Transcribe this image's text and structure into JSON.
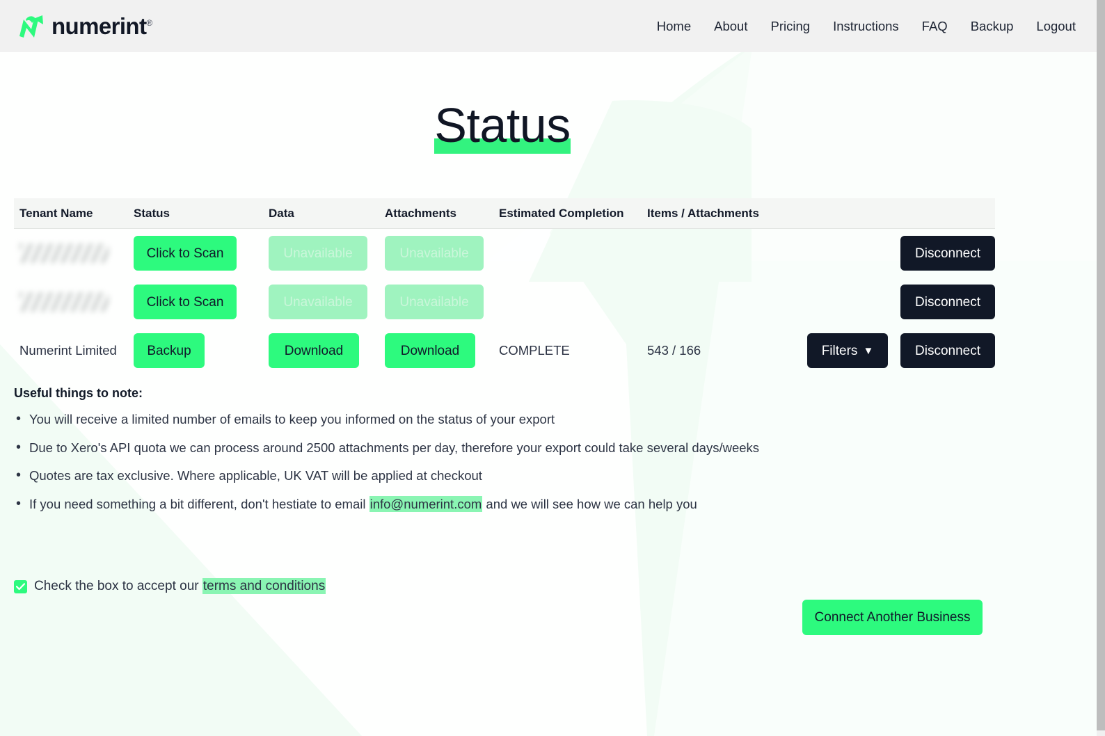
{
  "brand": {
    "name": "numerint",
    "registered_mark": "®",
    "logo_icon": "numerint-n-arrow-logo",
    "accent_green": "#2dfa7e",
    "dark_navy": "#111827"
  },
  "nav": {
    "items": [
      {
        "label": "Home"
      },
      {
        "label": "About"
      },
      {
        "label": "Pricing"
      },
      {
        "label": "Instructions"
      },
      {
        "label": "FAQ"
      },
      {
        "label": "Backup"
      },
      {
        "label": "Logout"
      }
    ]
  },
  "page": {
    "title": "Status"
  },
  "table": {
    "headers": {
      "tenant": "Tenant Name",
      "status": "Status",
      "data": "Data",
      "attachments": "Attachments",
      "estimated_completion": "Estimated Completion",
      "items_attachments": "Items / Attachments"
    },
    "rows": [
      {
        "tenant_name": "",
        "tenant_redacted": true,
        "status_label": "Click to Scan",
        "data_label": "Unavailable",
        "data_disabled": true,
        "attachments_label": "Unavailable",
        "attachments_disabled": true,
        "estimated_completion": "",
        "items_attachments": "",
        "has_filters": false,
        "filters_label": "Filters",
        "disconnect_label": "Disconnect"
      },
      {
        "tenant_name": "",
        "tenant_redacted": true,
        "status_label": "Click to Scan",
        "data_label": "Unavailable",
        "data_disabled": true,
        "attachments_label": "Unavailable",
        "attachments_disabled": true,
        "estimated_completion": "",
        "items_attachments": "",
        "has_filters": false,
        "filters_label": "Filters",
        "disconnect_label": "Disconnect"
      },
      {
        "tenant_name": "Numerint Limited",
        "tenant_redacted": false,
        "status_label": "Backup",
        "data_label": "Download",
        "data_disabled": false,
        "attachments_label": "Download",
        "attachments_disabled": false,
        "estimated_completion": "COMPLETE",
        "items_attachments": "543 / 166",
        "has_filters": true,
        "filters_label": "Filters",
        "filters_caret": "▼",
        "disconnect_label": "Disconnect"
      }
    ]
  },
  "notes": {
    "title": "Useful things to note:",
    "items": [
      {
        "text": "You will receive a limited number of emails to keep you informed on the status of your export"
      },
      {
        "text": "Due to Xero's API quota we can process around 2500 attachments per day, therefore your export could take several days/weeks"
      },
      {
        "text": "Quotes are tax exclusive. Where applicable, UK VAT will be applied at checkout"
      }
    ],
    "last_item": {
      "prefix": "If you need something a bit different, don't hestiate to email ",
      "email": "info@numerint.com",
      "suffix": " and we will see how we can help you"
    }
  },
  "terms": {
    "checked": true,
    "checkbox_icon": "check-icon",
    "prefix": "Check the box to accept our ",
    "link_label": "terms and conditions"
  },
  "actions": {
    "connect_another_business": "Connect Another Business"
  }
}
